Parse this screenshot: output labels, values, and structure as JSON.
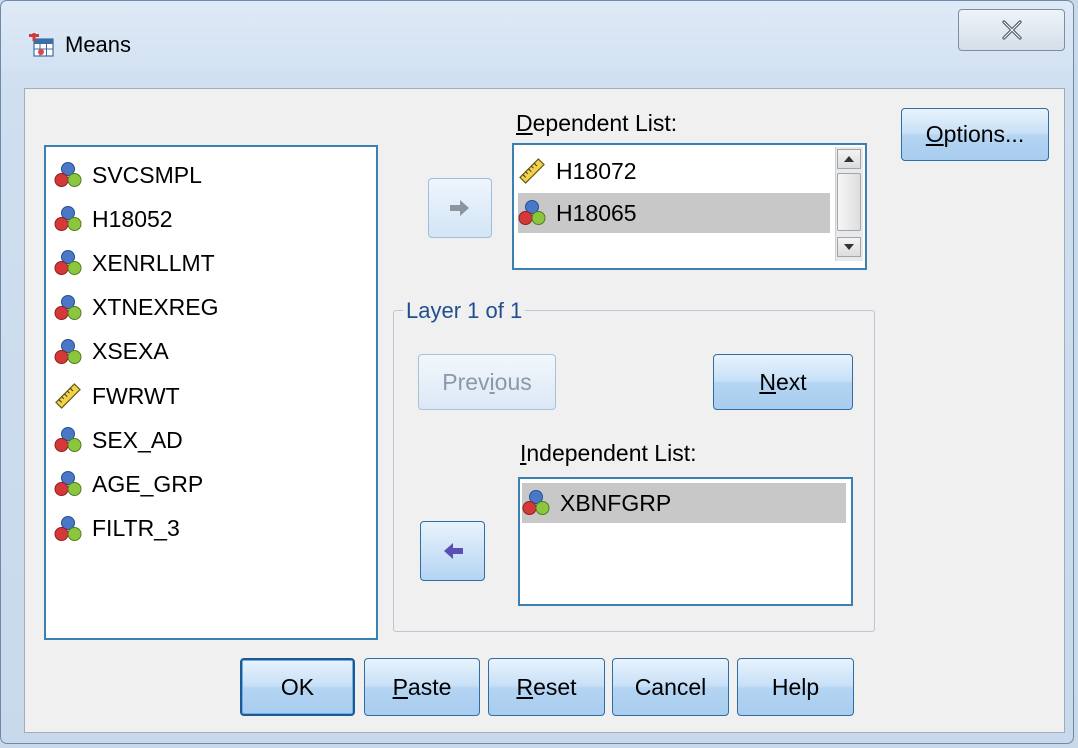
{
  "window": {
    "title": "Means",
    "close_label": "X"
  },
  "variables": [
    {
      "name": "SVCSMPL",
      "icon": "nominal-icon"
    },
    {
      "name": "H18052",
      "icon": "nominal-icon"
    },
    {
      "name": "XENRLLMT",
      "icon": "nominal-icon"
    },
    {
      "name": "XTNEXREG",
      "icon": "nominal-icon"
    },
    {
      "name": "XSEXA",
      "icon": "nominal-icon"
    },
    {
      "name": "FWRWT",
      "icon": "scale-ruler-icon"
    },
    {
      "name": "SEX_AD",
      "icon": "nominal-icon"
    },
    {
      "name": "AGE_GRP",
      "icon": "nominal-icon"
    },
    {
      "name": "FILTR_3",
      "icon": "nominal-icon"
    }
  ],
  "dependent": {
    "label_underlined": "D",
    "label_rest": "ependent List:",
    "items": [
      {
        "name": "H18072",
        "icon": "scale-ruler-icon",
        "selected": false
      },
      {
        "name": "H18065",
        "icon": "nominal-icon",
        "selected": true
      }
    ]
  },
  "layer": {
    "title": "Layer 1 of 1",
    "previous_pre": "Prev",
    "previous_u": "i",
    "previous_post": "ous",
    "next_u": "N",
    "next_post": "ext"
  },
  "independent": {
    "label_underlined": "I",
    "label_rest": "ndependent List:",
    "items": [
      {
        "name": "XBNFGRP",
        "icon": "nominal-icon",
        "selected": true
      }
    ]
  },
  "buttons": {
    "options_u": "O",
    "options_rest": "ptions...",
    "ok": "OK",
    "paste_u": "P",
    "paste_rest": "aste",
    "reset_u": "R",
    "reset_rest": "eset",
    "cancel": "Cancel",
    "help": "Help"
  },
  "colors": {
    "accent": "#3c7fb1",
    "button_top": "#e9f3fc",
    "button_bottom": "#a9cdef",
    "selection": "#c8c8c8"
  }
}
